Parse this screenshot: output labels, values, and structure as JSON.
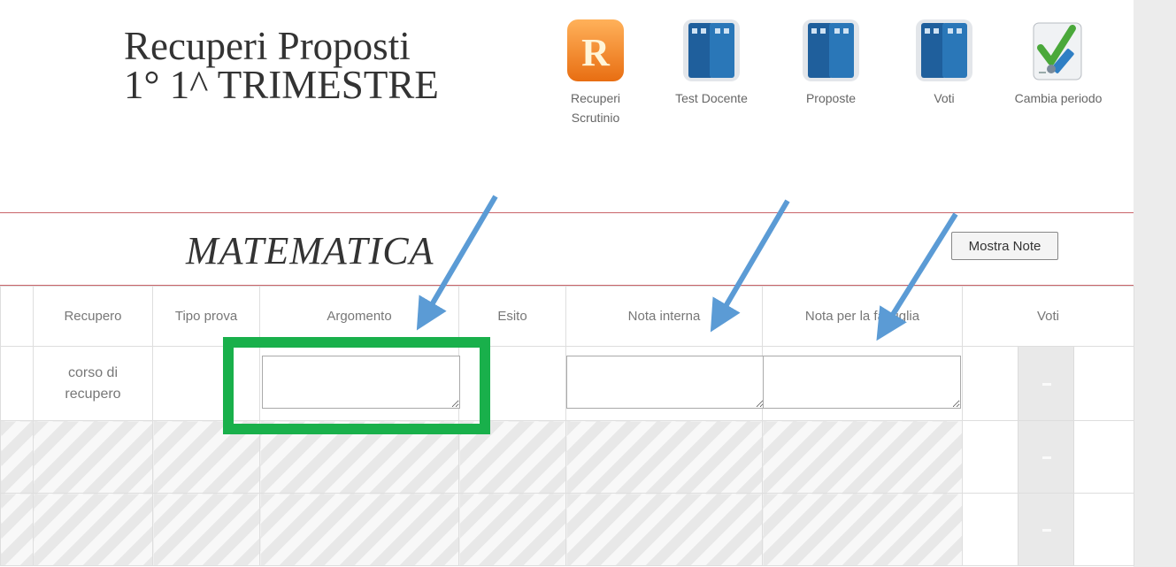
{
  "header": {
    "title_line1": "Recuperi Proposti",
    "title_line2": "1° 1^ TRIMESTRE"
  },
  "toolbar": [
    {
      "label": "Recuperi Scrutinio",
      "icon": "recuperi-r-icon"
    },
    {
      "label": "Test Docente",
      "icon": "register-book-icon"
    },
    {
      "label": "Proposte",
      "icon": "register-book-icon"
    },
    {
      "label": "Voti",
      "icon": "register-book-icon"
    },
    {
      "label": "Cambia periodo",
      "icon": "checkmark-pencil-icon"
    }
  ],
  "subject": {
    "name": "MATEMATICA",
    "note_button": "Mostra Note"
  },
  "table": {
    "headers": [
      "Recupero",
      "Tipo prova",
      "Argomento",
      "Esito",
      "Nota interna",
      "Nota per la famiglia",
      "Voti"
    ],
    "rows": [
      {
        "recupero": "corso di recupero",
        "tipo_prova": "",
        "argomento": "",
        "esito": "",
        "nota_interna": "",
        "nota_famiglia": ""
      }
    ]
  },
  "colors": {
    "accent_rule": "#c9646a",
    "highlight": "#19b04b",
    "arrow": "#5b9bd5"
  }
}
